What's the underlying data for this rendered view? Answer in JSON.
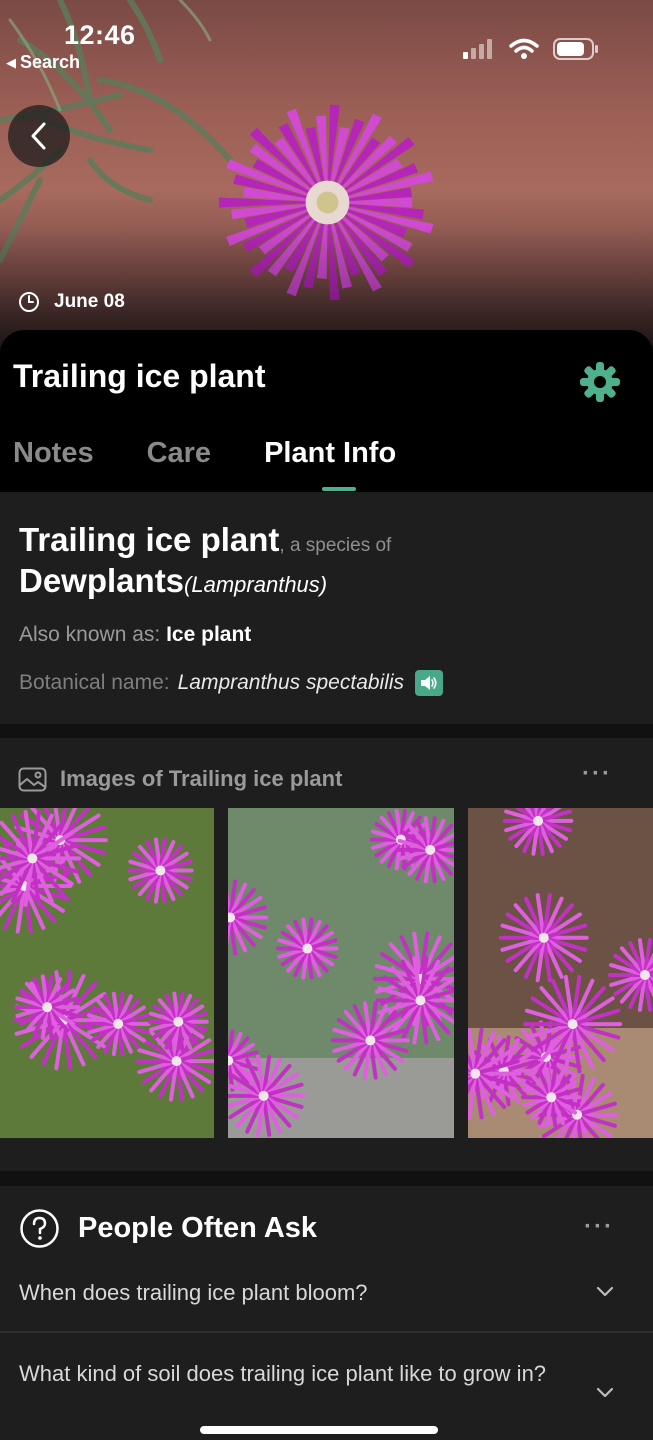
{
  "status_bar": {
    "time": "12:46",
    "back_label": "Search",
    "icons": [
      "cellular-signal-icon",
      "wifi-icon",
      "battery-icon"
    ]
  },
  "hero": {
    "date": "June 08"
  },
  "header": {
    "title": "Trailing ice plant",
    "tabs": [
      {
        "label": "Notes",
        "active": false
      },
      {
        "label": "Care",
        "active": false
      },
      {
        "label": "Plant Info",
        "active": true
      }
    ]
  },
  "info": {
    "common_name": "Trailing ice plant",
    "species_of": ", a species of",
    "family_common": "Dewplants",
    "genus": "(Lampranthus)",
    "aka_label": "Also known as:",
    "aka_value": "Ice plant",
    "botanical_label": "Botanical name:",
    "botanical_value": "Lampranthus spectabilis"
  },
  "images": {
    "heading": "Images of Trailing ice plant"
  },
  "people_ask": {
    "heading": "People Often Ask",
    "questions": [
      "When does trailing ice plant bloom?",
      "What kind of soil does trailing ice plant like to grow in?"
    ]
  },
  "colors": {
    "accent": "#4fb08e",
    "card_bg": "#1e1e1e",
    "sheet_bg": "#000000",
    "flower": "#c231c4"
  }
}
